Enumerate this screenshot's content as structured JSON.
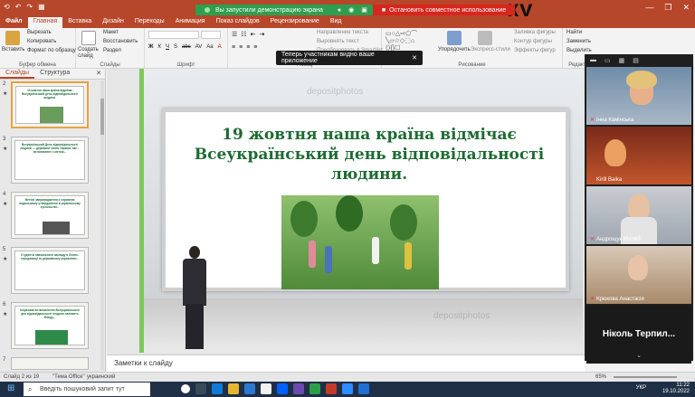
{
  "titlebar": {
    "quick_access": [
      "⟲",
      "↶",
      "↷",
      "▦"
    ],
    "doc_title": "ку",
    "controls": [
      "—",
      "❐",
      "✕"
    ]
  },
  "share_bar": {
    "message": "Вы запустили демонстрацию экрана",
    "stop_label": "Остановить совместное использование"
  },
  "tabs": [
    "Файл",
    "Главная",
    "Вставка",
    "Дизайн",
    "Переходы",
    "Анимация",
    "Показ слайдов",
    "Рецензирование",
    "Вид"
  ],
  "active_tab": "Главная",
  "ribbon": {
    "clipboard": {
      "paste": "Вставить",
      "cut": "Вырезать",
      "copy": "Копировать",
      "format": "Формат по образцу",
      "label": "Буфер обмена"
    },
    "slides": {
      "new": "Создать слайд",
      "layout": "Макет",
      "reset": "Восстановить",
      "section": "Раздел",
      "label": "Слайды"
    },
    "font": {
      "label": "Шрифт",
      "buttons": [
        "Ж",
        "К",
        "Ч",
        "S",
        "abc",
        "AV",
        "Aa",
        "A"
      ]
    },
    "paragraph": {
      "label": "Абзац",
      "text_direction": "Направление текста",
      "align_text": "Выровнять текст",
      "smartart": "Преобразовать в SmartArt"
    },
    "drawing": {
      "label": "Рисование",
      "arrange": "Упорядочить",
      "quick_styles": "Экспресс-стили",
      "fill": "Заливка фигуры",
      "outline": "Контур фигуры",
      "effects": "Эффекты фигур"
    },
    "editing": {
      "label": "Редакти...",
      "find": "Найти",
      "replace": "Заменить",
      "select": "Выделить"
    }
  },
  "left_pane": {
    "tabs": [
      "Слайды",
      "Структура"
    ],
    "close": "✕",
    "slides": [
      {
        "num": "2",
        "text": "19 жовтня наша країна відмічає Всеукраїнський день відповідальності людини."
      },
      {
        "num": "3",
        "text": "Всеукраїнський День відповідальності людини — державне свято України, яке... встановлене з метою..."
      },
      {
        "num": "4",
        "text": "Метою запровадження є сприяння подальшому утвердженню в українському суспільстві..."
      },
      {
        "num": "5",
        "text": "Студенти навчального закладу в бізнес-середовищі та державному управлінні..."
      },
      {
        "num": "6",
        "text": "Ініціатива встановлення Всеукраїнського дня відповідальності людини належить Фонду..."
      },
      {
        "num": "7",
        "text": ""
      }
    ]
  },
  "slide": {
    "title": "19 жовтня наша країна відмічає Всеукраїнський день відповідальності людини.",
    "watermark": "depositphotos"
  },
  "notes": {
    "placeholder": "Заметки к слайду"
  },
  "toast": {
    "text": "Теперь участникам видно ваше приложение",
    "close": "✕"
  },
  "participants": {
    "tiles": [
      {
        "name": "Інна Камінська"
      },
      {
        "name": "Kirill Baika"
      },
      {
        "name": "Андрощук Матвій"
      },
      {
        "name": "Крюкова Анастасія"
      },
      {
        "name": "Ніколь Терпил..."
      }
    ],
    "more": "⌄"
  },
  "statusbar": {
    "slide_info": "Слайд 2 из 19",
    "theme": "\"Тема Office\"",
    "language": "украинский",
    "zoom": "65%"
  },
  "taskbar": {
    "search_placeholder": "Введіть пошуковий запит тут",
    "language": "УКР",
    "time": "11:22",
    "date": "19.10.2022"
  },
  "colors": {
    "accent": "#b7472a",
    "share_green": "#2e9e4f",
    "stop_red": "#d7261e",
    "slide_green": "#1e6b33",
    "taskbar": "#1f2f45"
  }
}
